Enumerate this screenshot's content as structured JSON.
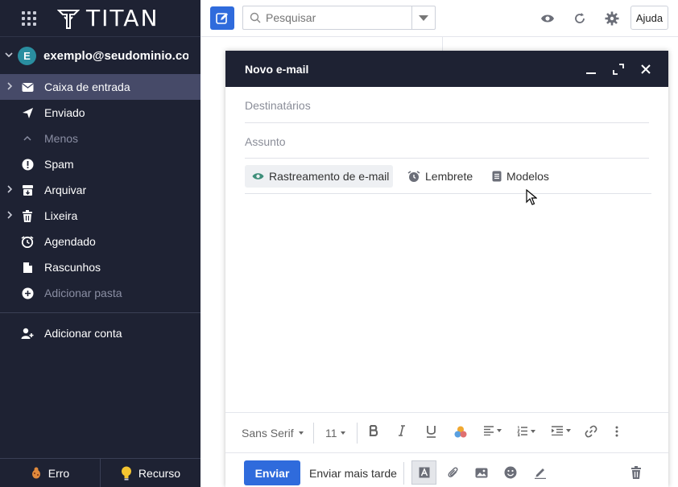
{
  "brand": {
    "name": "TITAN"
  },
  "account": {
    "initial": "E",
    "email": "exemplo@seudominio.co..."
  },
  "folders": [
    {
      "label": "Caixa de entrada",
      "icon": "inbox-icon",
      "active": true,
      "expandable": true
    },
    {
      "label": "Enviado",
      "icon": "send-icon",
      "active": false,
      "expandable": false
    },
    {
      "label": "Menos",
      "icon": "chevron-up-icon",
      "active": false,
      "expandable": false,
      "muted": true
    },
    {
      "label": "Spam",
      "icon": "alert-icon",
      "active": false,
      "expandable": false
    },
    {
      "label": "Arquivar",
      "icon": "archive-icon",
      "active": false,
      "expandable": true
    },
    {
      "label": "Lixeira",
      "icon": "trash-icon",
      "active": false,
      "expandable": true
    },
    {
      "label": "Agendado",
      "icon": "clock-icon",
      "active": false,
      "expandable": false
    },
    {
      "label": "Rascunhos",
      "icon": "draft-icon",
      "active": false,
      "expandable": false
    },
    {
      "label": "Adicionar pasta",
      "icon": "plus-circle-icon",
      "active": false,
      "expandable": false,
      "muted": true
    }
  ],
  "add_account": "Adicionar conta",
  "bottom": {
    "bug": "Erro",
    "feature": "Recurso"
  },
  "topbar": {
    "search_placeholder": "Pesquisar",
    "help": "Ajuda"
  },
  "compose": {
    "title": "Novo e-mail",
    "to_placeholder": "Destinatários",
    "subject_placeholder": "Assunto",
    "chips": {
      "tracking": "Rastreamento de e-mail",
      "reminder": "Lembrete",
      "templates": "Modelos"
    },
    "format": {
      "font": "Sans Serif",
      "size": "11"
    },
    "send": "Enviar",
    "send_later": "Enviar mais tarde"
  },
  "colors": {
    "sidebar": "#1e2233",
    "active": "#464a68",
    "accent": "#2f6bdc"
  }
}
